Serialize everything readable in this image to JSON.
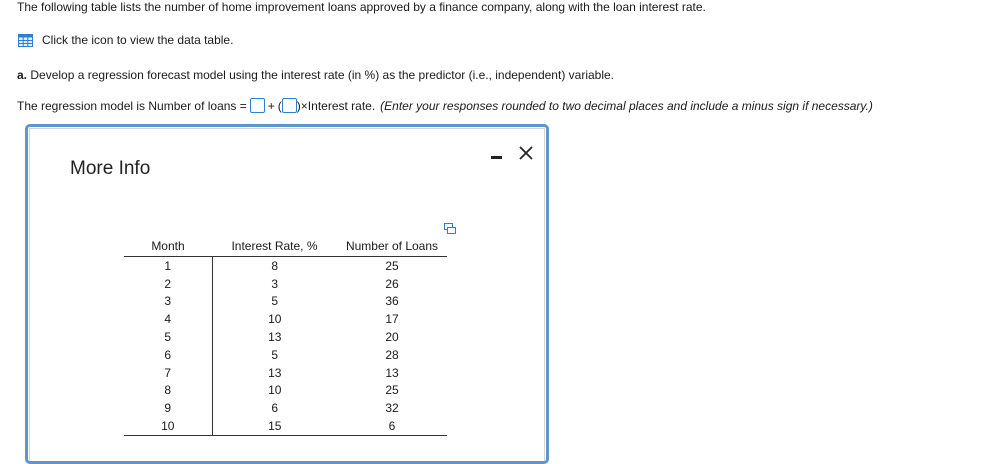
{
  "intro": "The following table lists the number of home improvement loans approved by a finance company, along with the loan interest rate.",
  "view_link": {
    "icon": "table-icon",
    "label": "Click the icon to view the data table."
  },
  "part_a": {
    "label": "a.",
    "text": "Develop a regression forecast model using the interest rate (in %) as the predictor (i.e., independent) variable."
  },
  "model": {
    "prefix": "The regression model is Number of loans =",
    "plus": "+",
    "open_paren": "(",
    "close_paren": ")",
    "suffix": "×Interest rate.",
    "hint": "(Enter your responses rounded to two decimal places and include a minus sign if necessary.)",
    "intercept_value": "",
    "slope_value": ""
  },
  "modal": {
    "title": "More Info",
    "minimize_icon": "minimize-icon",
    "close_icon": "close-icon",
    "copy_icon": "copy-icon"
  },
  "table": {
    "headers": [
      "Month",
      "Interest Rate, %",
      "Number of Loans"
    ],
    "rows": [
      [
        "1",
        "8",
        "25"
      ],
      [
        "2",
        "3",
        "26"
      ],
      [
        "3",
        "5",
        "36"
      ],
      [
        "4",
        "10",
        "17"
      ],
      [
        "5",
        "13",
        "20"
      ],
      [
        "6",
        "5",
        "28"
      ],
      [
        "7",
        "13",
        "13"
      ],
      [
        "8",
        "10",
        "25"
      ],
      [
        "9",
        "6",
        "32"
      ],
      [
        "10",
        "15",
        "6"
      ]
    ]
  },
  "colors": {
    "modal_border": "#5e96d0",
    "input_border": "#2d7fd3",
    "icon_blue": "#2d7fd3"
  }
}
